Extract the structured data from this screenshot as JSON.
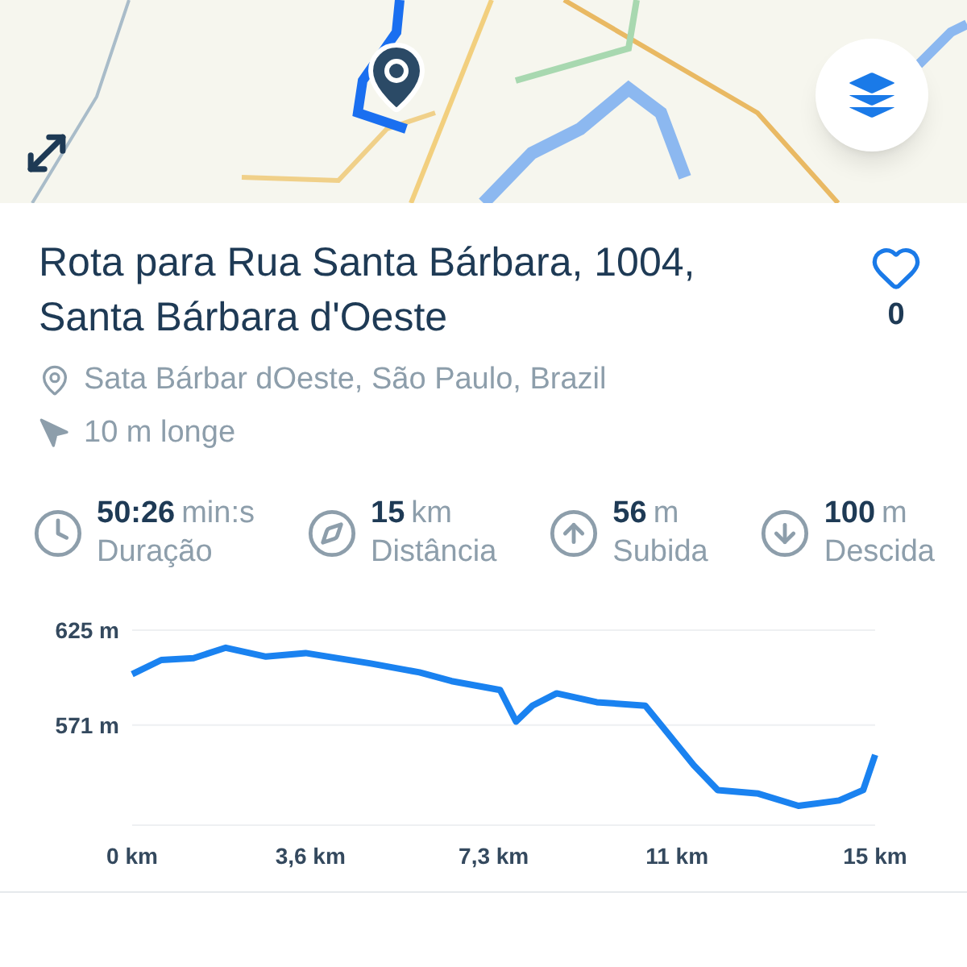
{
  "route": {
    "title": "Rota para Rua Santa Bárbara, 1004, Santa Bárbara d'Oeste",
    "favorite": false,
    "likes": "0",
    "location": "Sata Bárbar dOeste, São Paulo, Brazil",
    "distance_away": "10 m longe"
  },
  "stats": [
    {
      "kind": "clock",
      "value": "50:26",
      "unit": "min:s",
      "label": "Duração"
    },
    {
      "kind": "compass",
      "value": "15",
      "unit": "km",
      "label": "Distância"
    },
    {
      "kind": "up",
      "value": "56",
      "unit": "m",
      "label": "Subida"
    },
    {
      "kind": "down",
      "value": "100",
      "unit": "m",
      "label": "Descida"
    }
  ],
  "elevation": {
    "chart_data": {
      "type": "line",
      "xlim": [
        0,
        15
      ],
      "ylim": [
        514,
        625
      ],
      "xticks": [
        {
          "value": 0,
          "label": "0 km"
        },
        {
          "value": 3.6,
          "label": "3,6 km"
        },
        {
          "value": 7.3,
          "label": "7,3 km"
        },
        {
          "value": 11,
          "label": "11 km"
        },
        {
          "value": 15,
          "label": "15 km"
        }
      ],
      "yticks": [
        {
          "value": 625,
          "label": "625 m"
        },
        {
          "value": 571,
          "label": "571 m"
        }
      ],
      "x": [
        0,
        0.59,
        1.24,
        1.89,
        2.7,
        3.5,
        4.82,
        5.8,
        6.45,
        7.43,
        7.75,
        8.08,
        8.57,
        9.38,
        10.36,
        10.68,
        11.34,
        11.82,
        12.64,
        13.45,
        14.27,
        14.76,
        15
      ],
      "series": [
        {
          "color": "#1a82f0",
          "values": [
            600,
            608,
            609,
            615,
            610,
            612,
            606,
            601,
            596,
            591,
            573,
            582,
            589,
            584,
            582,
            571,
            548,
            534,
            532,
            525,
            528,
            534,
            554
          ]
        }
      ]
    }
  }
}
